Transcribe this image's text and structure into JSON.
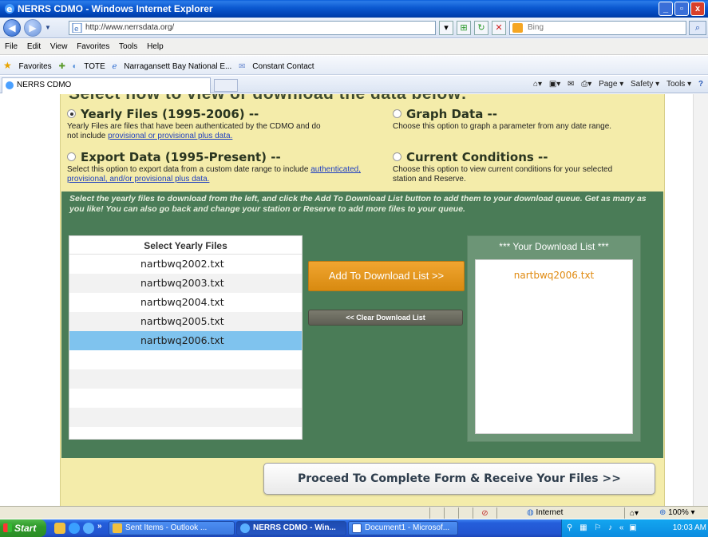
{
  "window": {
    "title": "NERRS CDMO - Windows Internet Explorer",
    "buttons": [
      "_",
      "▫",
      "x"
    ]
  },
  "address_bar": {
    "url": "http://www.nerrsdata.org/",
    "search_placeholder": "Bing"
  },
  "menu": {
    "items": [
      "File",
      "Edit",
      "View",
      "Favorites",
      "Tools",
      "Help"
    ]
  },
  "favorites_bar": {
    "label": "Favorites",
    "links": [
      "TOTE",
      "Narragansett Bay National E...",
      "Constant Contact"
    ]
  },
  "tab": {
    "label": "NERRS CDMO"
  },
  "command_bar": {
    "page": "Page ▾",
    "safety": "Safety ▾",
    "tools": "Tools ▾",
    "help": "?"
  },
  "page": {
    "heading_cut": "Select how to view or download the data below:",
    "options": {
      "yearly": {
        "title": "Yearly Files (1995-2006) --",
        "desc": "Yearly Files are files that have been authenticated by the CDMO and do not include ",
        "link": "provisional or provisional plus data.",
        "selected": true
      },
      "graph": {
        "title": "Graph Data --",
        "desc": "Choose this option to graph a parameter from any date range.",
        "selected": false
      },
      "export": {
        "title": "Export Data (1995-Present) --",
        "desc": "Select this option to export data from a custom date range to include ",
        "link": "authenticated, provisional, and/or provisional plus data.",
        "selected": false
      },
      "current": {
        "title": "Current Conditions --",
        "desc": "Choose this option to view current conditions for your selected station and Reserve.",
        "selected": false
      }
    },
    "instructions": "Select the yearly files to download from the left, and click the Add To Download List button to add them to your download queue. Get as many as you like! You can also go back and change your station or Reserve to add more files to your queue.",
    "yearly_list": {
      "header": "Select Yearly Files",
      "files": [
        "nartbwq2002.txt",
        "nartbwq2003.txt",
        "nartbwq2004.txt",
        "nartbwq2005.txt",
        "nartbwq2006.txt"
      ],
      "selected": "nartbwq2006.txt"
    },
    "add_button": "Add To Download List >>",
    "clear_button": "<< Clear Download List",
    "download_list": {
      "header": "*** Your  Download List ***",
      "items": [
        "nartbwq2006.txt"
      ]
    },
    "proceed_button": "Proceed To Complete Form & Receive Your Files >>"
  },
  "status_bar": {
    "zone": "Internet",
    "zoom": "100%"
  },
  "taskbar": {
    "start": "Start",
    "tasks": [
      "Sent Items - Outlook ...",
      "NERRS CDMO - Win...",
      "Document1 - Microsof..."
    ],
    "active_task": "NERRS CDMO - Win...",
    "clock": "10:03 AM"
  },
  "colors": {
    "cream": "#f4ecaa",
    "green_panel": "#4a7c57",
    "orange_button": "#e89820",
    "selected_row": "#7fc3ee",
    "download_item": "#e08a10"
  }
}
